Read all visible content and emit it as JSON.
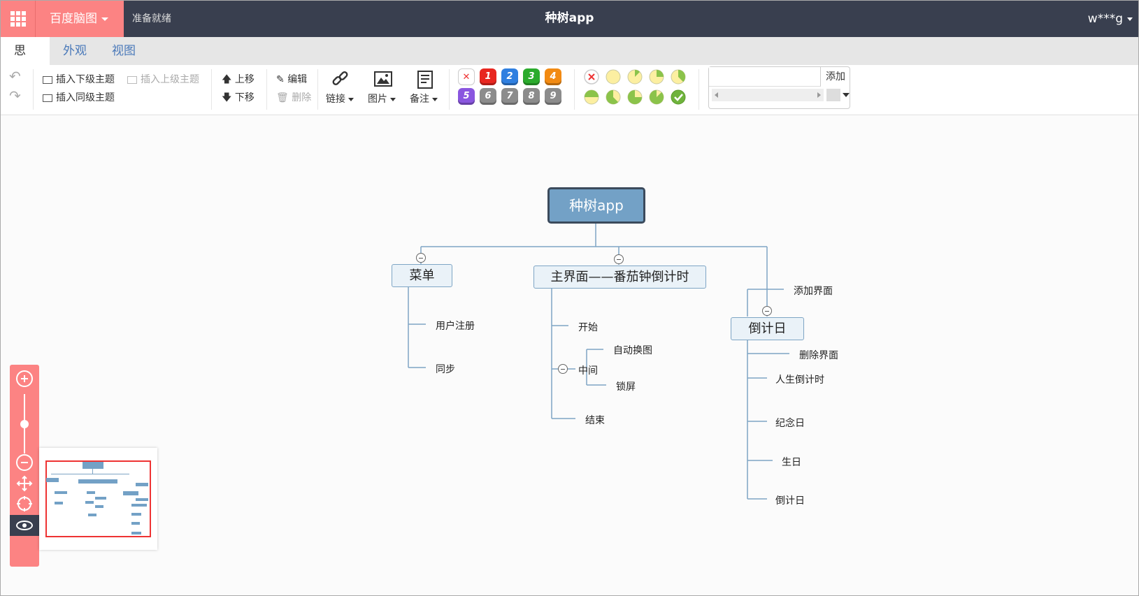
{
  "topbar": {
    "brand": "百度脑图",
    "status": "准备就绪",
    "title": "种树app",
    "user": "w***g"
  },
  "tabs": [
    "思路",
    "外观",
    "视图"
  ],
  "toolbar": {
    "insert_child": "插入下级主题",
    "insert_parent": "插入上级主题",
    "insert_sibling": "插入同级主题",
    "move_up": "上移",
    "move_down": "下移",
    "edit": "编辑",
    "delete": "删除",
    "link": "链接",
    "image": "图片",
    "note": "备注",
    "priorities": [
      "1",
      "2",
      "3",
      "4",
      "5",
      "6",
      "7",
      "8",
      "9"
    ],
    "priority_colors": [
      "#e8261f",
      "#2f7fe0",
      "#2bab2d",
      "#f28a12",
      "#8a56df",
      "#8c8c8c",
      "#8c8c8c",
      "#8c8c8c",
      "#8c8c8c"
    ],
    "resource_add": "添加"
  },
  "mindmap": {
    "root": "种树app",
    "branches": {
      "menu": {
        "label": "菜单",
        "children": [
          "用户注册",
          "同步"
        ]
      },
      "main": {
        "label": "主界面——番茄钟倒计时",
        "children": [
          "开始",
          "中间",
          "结束"
        ],
        "middle_children": [
          "自动换图",
          "锁屏"
        ]
      },
      "countdown": {
        "label": "倒计日",
        "children": [
          "添加界面",
          "删除界面",
          "人生倒计时",
          "纪念日",
          "生日",
          "倒计日"
        ]
      }
    }
  },
  "colors": {
    "accent": "#fc8383",
    "topbar": "#393f4f",
    "root_node": "#73a1c6",
    "link": "#4a79b9"
  }
}
